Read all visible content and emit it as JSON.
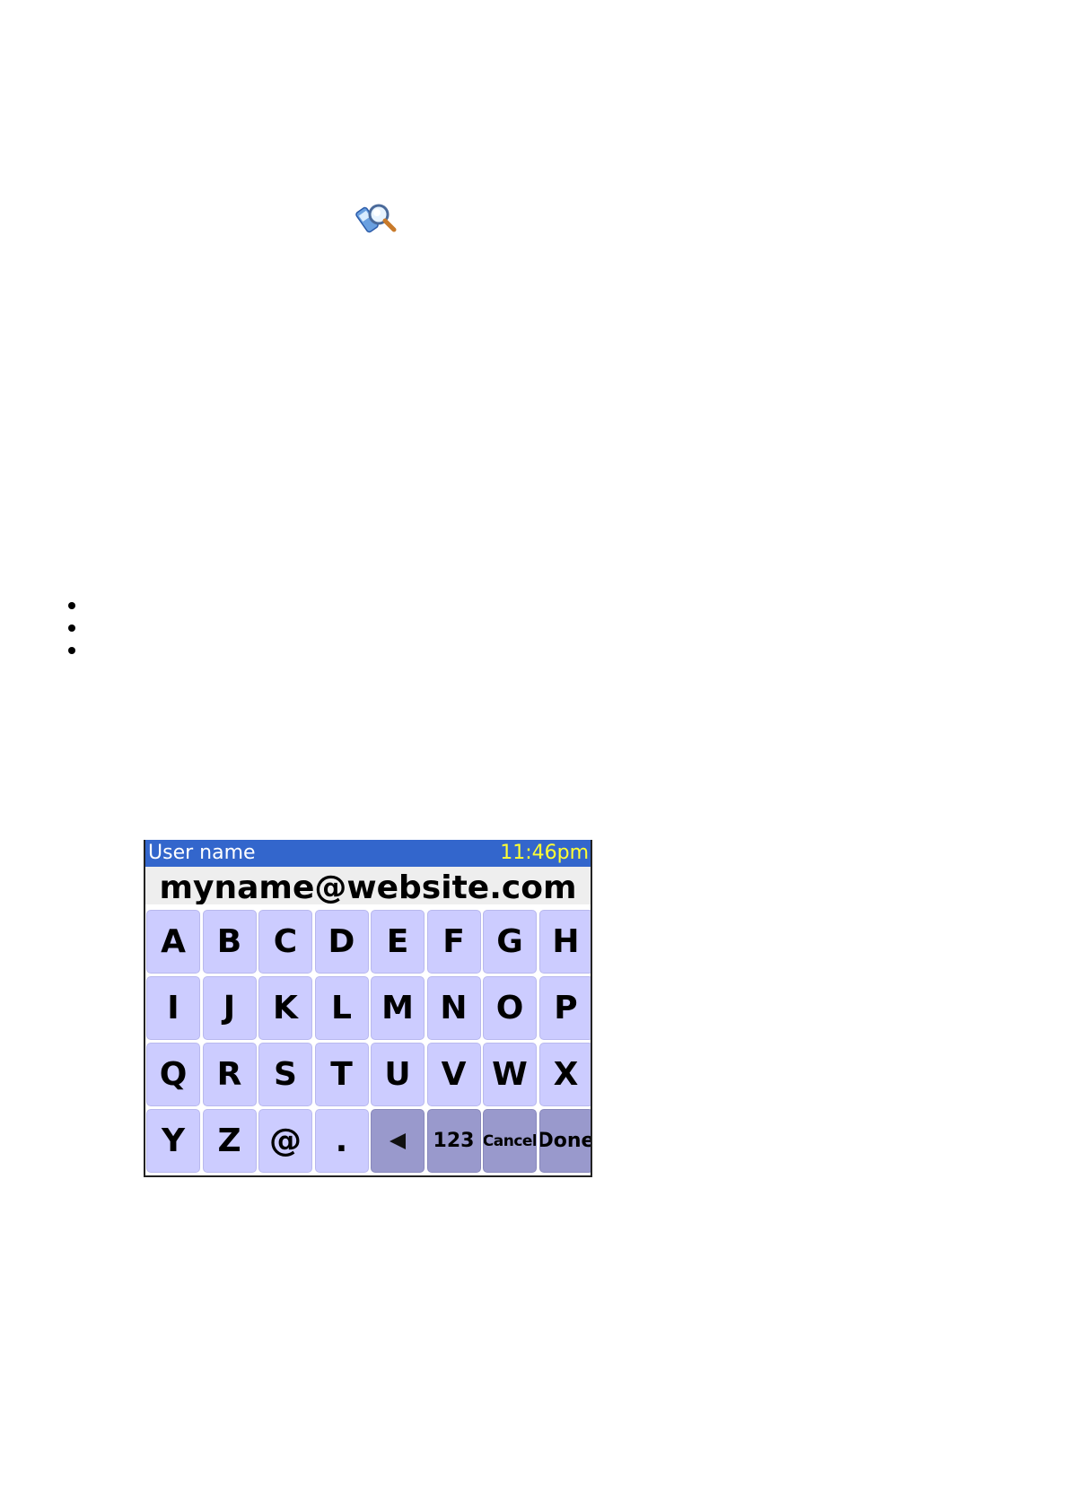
{
  "icons": {
    "search_icon": "phone-magnifier-icon",
    "backspace_icon": "backspace-arrow-icon"
  },
  "device": {
    "title": "User name",
    "clock": "11:46pm",
    "entry_value": "myname@website.com"
  },
  "keyboard": {
    "rows": [
      [
        "A",
        "B",
        "C",
        "D",
        "E",
        "F",
        "G",
        "H"
      ],
      [
        "I",
        "J",
        "K",
        "L",
        "M",
        "N",
        "O",
        "P"
      ],
      [
        "Q",
        "R",
        "S",
        "T",
        "U",
        "V",
        "W",
        "X"
      ],
      [
        "Y",
        "Z",
        "@",
        "."
      ]
    ],
    "function_keys": {
      "numbers": "123",
      "cancel": "Cancel",
      "done": "Done"
    }
  },
  "colors": {
    "title_bar": "#3366cc",
    "clock_text": "#ffff33",
    "key": "#ccccff",
    "function_key": "#9999cc"
  }
}
